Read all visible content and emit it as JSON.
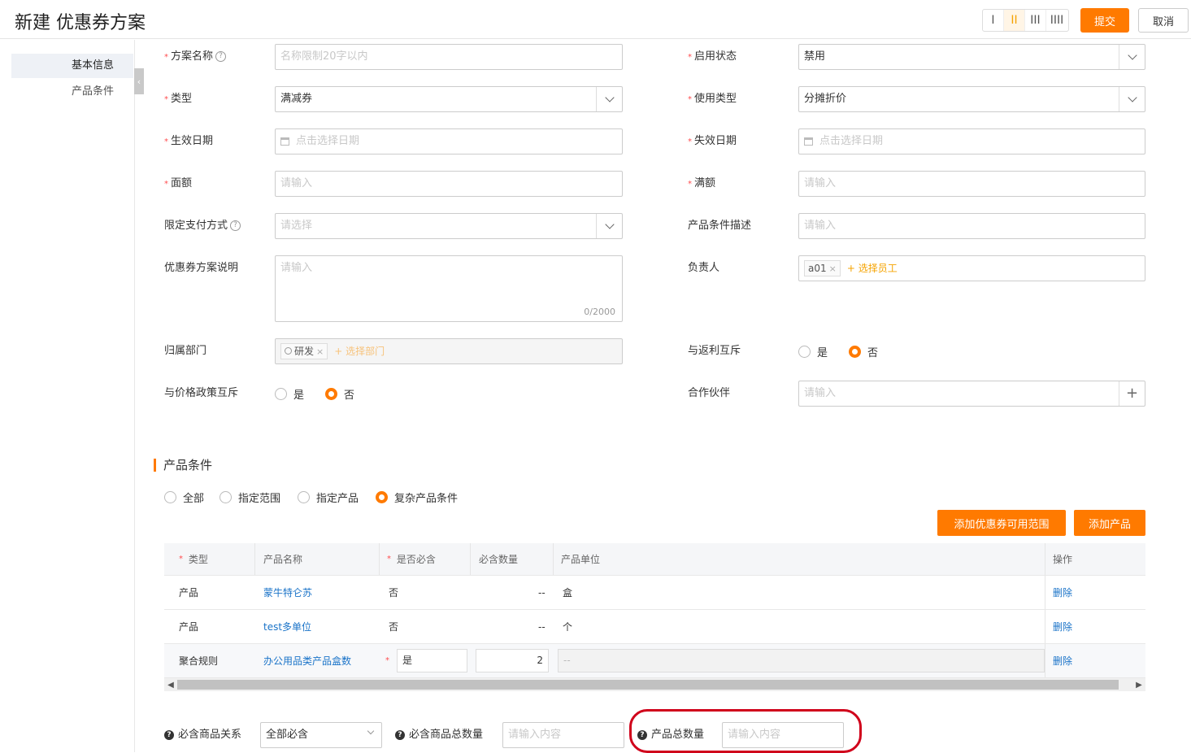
{
  "header": {
    "title": "新建 优惠券方案",
    "view_options": [
      "I",
      "II",
      "III",
      "IIII"
    ],
    "submit_label": "提交",
    "cancel_label": "取消"
  },
  "sidebar": {
    "items": [
      {
        "label": "基本信息",
        "active": true
      },
      {
        "label": "产品条件",
        "active": false
      }
    ]
  },
  "form": {
    "scheme_name": {
      "label": "方案名称",
      "placeholder": "名称限制20字以内"
    },
    "enable_status": {
      "label": "启用状态",
      "value": "禁用"
    },
    "type": {
      "label": "类型",
      "value": "满减券"
    },
    "usage_type": {
      "label": "使用类型",
      "value": "分摊折价"
    },
    "effective_date": {
      "label": "生效日期",
      "placeholder": "点击选择日期"
    },
    "expiry_date": {
      "label": "失效日期",
      "placeholder": "点击选择日期"
    },
    "face_value": {
      "label": "面额",
      "placeholder": "请输入"
    },
    "threshold": {
      "label": "满额",
      "placeholder": "请输入"
    },
    "payment_method": {
      "label": "限定支付方式",
      "placeholder": "请选择"
    },
    "product_condition_desc": {
      "label": "产品条件描述",
      "placeholder": "请输入"
    },
    "scheme_desc": {
      "label": "优惠券方案说明",
      "placeholder": "请输入",
      "counter": "0/2000"
    },
    "owner": {
      "label": "负责人",
      "tag": "a01",
      "add_label": "+ 选择员工"
    },
    "department": {
      "label": "归属部门",
      "tag": "研发",
      "add_label": "+ 选择部门"
    },
    "rebate_exclusive": {
      "label": "与返利互斥",
      "yes": "是",
      "no": "否",
      "value": "否"
    },
    "price_policy_exclusive": {
      "label": "与价格政策互斥",
      "yes": "是",
      "no": "否",
      "value": "否"
    },
    "partner": {
      "label": "合作伙伴",
      "placeholder": "请输入"
    }
  },
  "product_section": {
    "title": "产品条件",
    "options": [
      "全部",
      "指定范围",
      "指定产品",
      "复杂产品条件"
    ],
    "selected": "复杂产品条件",
    "add_scope_label": "添加优惠券可用范围",
    "add_product_label": "添加产品",
    "table": {
      "headers": [
        "类型",
        "产品名称",
        "是否必含",
        "必含数量",
        "产品单位",
        "操作"
      ],
      "rows": [
        {
          "type": "产品",
          "name": "蒙牛特仑苏",
          "required": "否",
          "qty": "--",
          "unit": "盒",
          "action": "删除"
        },
        {
          "type": "产品",
          "name": "test多单位",
          "required": "否",
          "qty": "--",
          "unit": "个",
          "action": "删除"
        },
        {
          "type": "聚合规则",
          "name": "办公用品类产品盒数",
          "required": "是",
          "qty": "2",
          "unit": "--",
          "action": "删除"
        }
      ]
    },
    "bottom": {
      "relation_label": "必含商品关系",
      "relation_value": "全部必含",
      "required_total_label": "必含商品总数量",
      "required_total_placeholder": "请输入内容",
      "total_qty_label": "产品总数量",
      "total_qty_placeholder": "请输入内容"
    }
  },
  "colors": {
    "accent": "#ff7a00",
    "link": "#1a73c8",
    "required": "#ff4d4f",
    "highlight": "#d0021b"
  }
}
